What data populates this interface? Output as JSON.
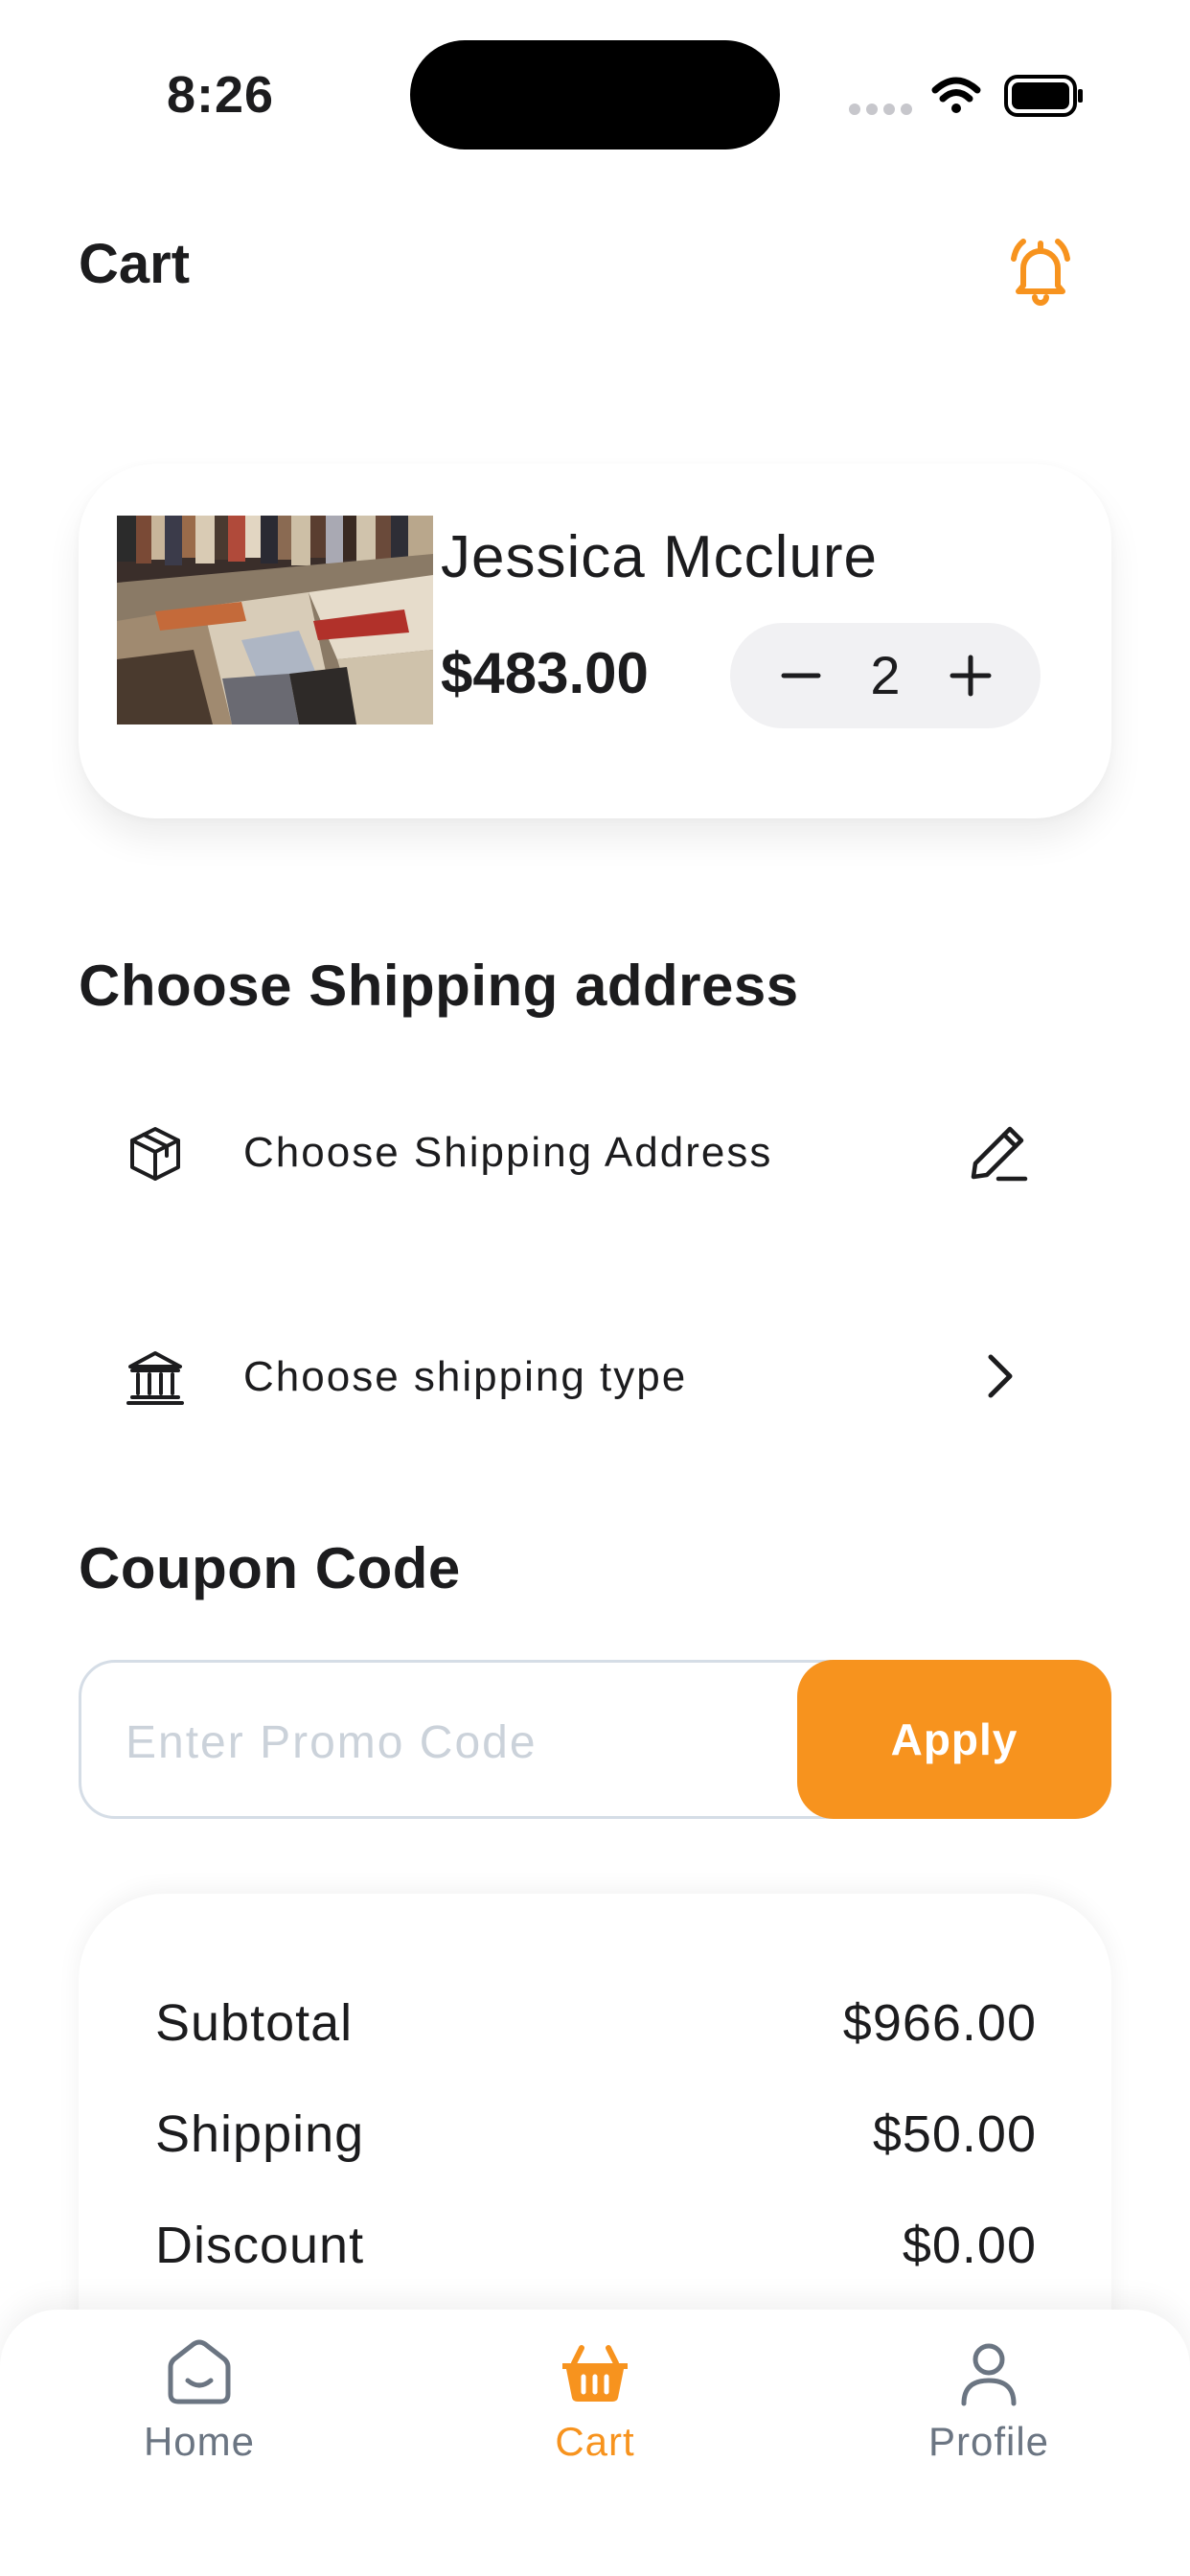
{
  "status_bar": {
    "time": "8:26"
  },
  "header": {
    "title": "Cart",
    "bell_icon": "bell-ringing-icon",
    "accent": "#F7931E"
  },
  "cart": {
    "items": [
      {
        "name": "Jessica Mcclure",
        "price": "$483.00",
        "quantity": "2",
        "image": "carpet-rugs-photo"
      }
    ]
  },
  "shipping": {
    "title": "Choose Shipping address",
    "address_label": "Choose Shipping Address",
    "address_icon": "package-box-icon",
    "address_action_icon": "pencil-edit-icon",
    "type_label": "Choose shipping type",
    "type_icon": "bank-building-icon",
    "type_action_icon": "chevron-right-icon"
  },
  "coupon": {
    "title": "Coupon Code",
    "placeholder": "Enter Promo Code",
    "value": "",
    "apply_label": "Apply"
  },
  "summary": {
    "rows": [
      {
        "label": "Subtotal",
        "value": "$966.00"
      },
      {
        "label": "Shipping",
        "value": "$50.00"
      },
      {
        "label": "Discount",
        "value": "$0.00"
      }
    ]
  },
  "tabs": [
    {
      "label": "Home",
      "icon": "home-icon",
      "active": false
    },
    {
      "label": "Cart",
      "icon": "basket-icon",
      "active": true
    },
    {
      "label": "Profile",
      "icon": "user-icon",
      "active": false
    }
  ],
  "colors": {
    "accent": "#F7931E",
    "text": "#1C1C1E",
    "muted": "#6B7582",
    "placeholder": "#CBD2DA"
  }
}
